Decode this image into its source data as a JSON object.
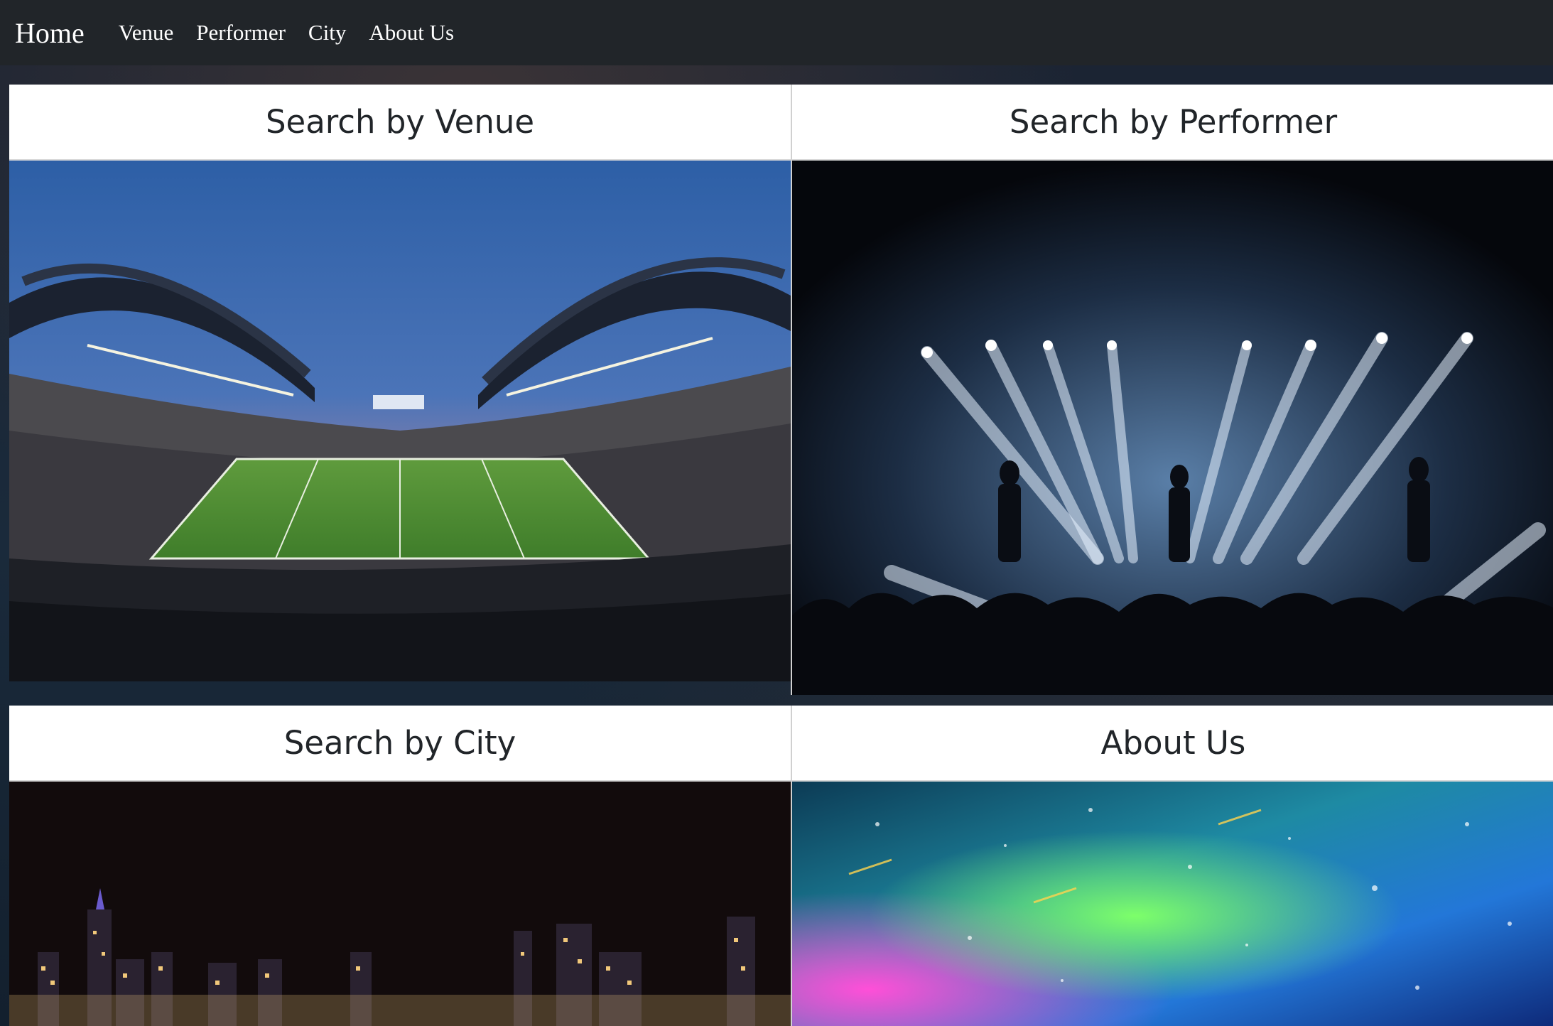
{
  "navbar": {
    "brand": "Home",
    "links": [
      "Venue",
      "Performer",
      "City",
      "About Us"
    ]
  },
  "cards": {
    "venue": {
      "title": "Search by Venue",
      "image": "stadium-photo"
    },
    "performer": {
      "title": "Search by Performer",
      "image": "concert-stage-photo"
    },
    "city": {
      "title": "Search by City",
      "image": "city-skyline-photo"
    },
    "about": {
      "title": "About Us",
      "image": "festival-lights-photo"
    }
  },
  "colors": {
    "navbar": "#212529",
    "card_header_bg": "#ffffff",
    "title_text": "#212529"
  }
}
